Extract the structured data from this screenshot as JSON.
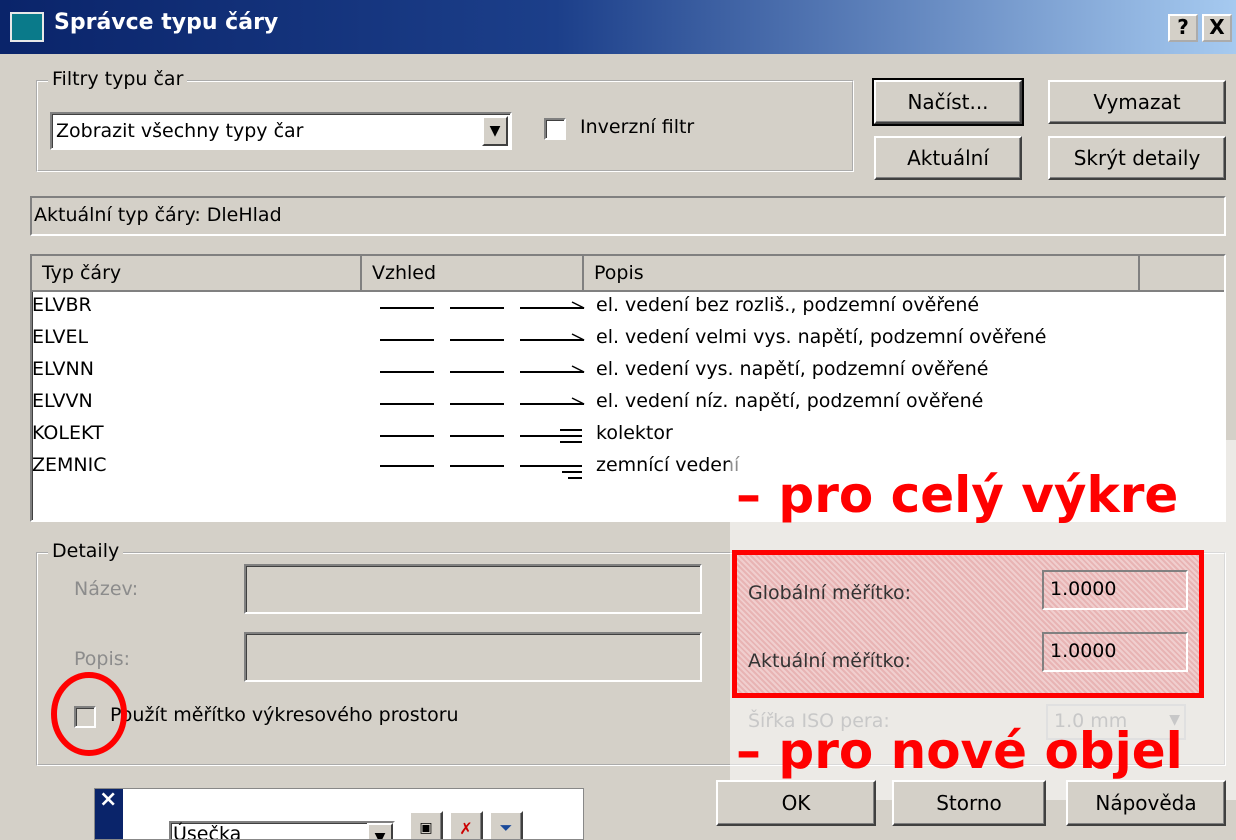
{
  "window": {
    "title": "Správce typu čáry",
    "help_button": "?",
    "close_button": "X"
  },
  "filters": {
    "group_label": "Filtry typu čar",
    "dropdown_value": "Zobrazit všechny typy čar",
    "invert_label": "Inverzní filtr"
  },
  "buttons": {
    "load": "Načíst...",
    "delete": "Vymazat",
    "current": "Aktuální",
    "hide_details": "Skrýt detaily",
    "ok": "OK",
    "cancel": "Storno",
    "help": "Nápověda"
  },
  "current_linetype": "Aktuální typ čáry:  DleHlad",
  "table": {
    "headers": [
      "Typ čáry",
      "Vzhled",
      "Popis"
    ],
    "rows": [
      {
        "name": "ELVBR",
        "desc": "el. vedení bez rozliš., podzemní ověřené",
        "symbol": "arrow"
      },
      {
        "name": "ELVEL",
        "desc": "el. vedení velmi vys. napětí, podzemní ověřené",
        "symbol": "arrow"
      },
      {
        "name": "ELVNN",
        "desc": "el. vedení vys. napětí, podzemní ověřené",
        "symbol": "arrow"
      },
      {
        "name": "ELVVN",
        "desc": "el. vedení níz. napětí, podzemní ověřené",
        "symbol": "arrow"
      },
      {
        "name": "KOLEKT",
        "desc": "kolektor",
        "symbol": "triple"
      },
      {
        "name": "ZEMNIC",
        "desc": "zemnící vedení",
        "symbol": "ground"
      }
    ]
  },
  "details": {
    "group_label": "Detaily",
    "name_label": "Název:",
    "desc_label": "Popis:",
    "paper_space_label": "Použít měřítko výkresového prostoru",
    "global_scale_label": "Globální měřítko:",
    "global_scale_value": "1.0000",
    "current_scale_label": "Aktuální měřítko:",
    "current_scale_value": "1.0000",
    "iso_pen_label": "Šířka ISO pera:",
    "iso_pen_value": "1.0 mm"
  },
  "annotations": {
    "whole_drawing": "– pro celý výkre",
    "new_objects": "– pro nové objel"
  },
  "toolbar": {
    "close": "×",
    "dropdown_value": "Úsečka"
  },
  "colors": {
    "annotation_red": "#ff0000",
    "title_blue": "#0a246a"
  }
}
